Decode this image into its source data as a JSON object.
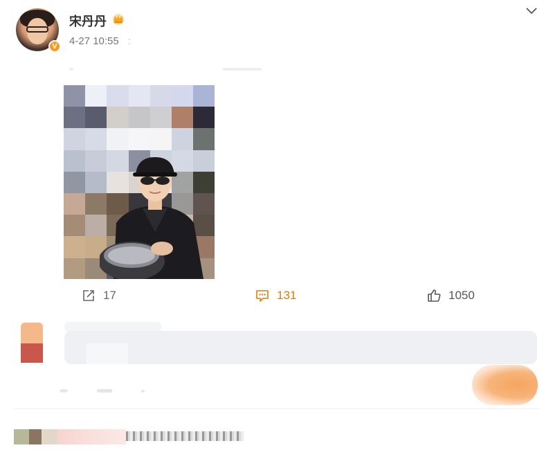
{
  "post": {
    "author": "宋丹丹",
    "verified_badge": "V",
    "time": "4-27 10:55",
    "time_tail": ":",
    "menu_icon": "chevron-down-icon",
    "crown_icon": "crown-icon"
  },
  "actions": {
    "forward_count": "17",
    "comment_count": "131",
    "like_count": "1050",
    "comment_color": "#e07b0c"
  },
  "mosaic_colors": [
    [
      "#8e93a8",
      "#eef0f8",
      "#d9dced",
      "#e4e7f3",
      "#d6d9ea",
      "#d4d8ec",
      "#a9b4d7"
    ],
    [
      "#6d6f83",
      "#5a5c6e",
      "#d2cfca",
      "#c6c5c7",
      "#cfcfd2",
      "#b07f68",
      "#2b2a36"
    ],
    [
      "#cfd4e0",
      "#d7dbe6",
      "#f1f2f5",
      "#f6f6f8",
      "#f5f5f6",
      "#cdd3df",
      "#6c7270"
    ],
    [
      "#bac1ce",
      "#c7ccd8",
      "#d3d8e3",
      "#8b8fa0",
      "#cdd3df",
      "#d5d9e3",
      "#c9cfda"
    ],
    [
      "#9097a3",
      "#b5bbc8",
      "#e5e2e0",
      "#d9d4d0",
      "#e9e9ec",
      "#a1a3a3",
      "#3d3e34"
    ],
    [
      "#c6a897",
      "#8c7a66",
      "#6d5a48",
      "#39373c",
      "#3e3b40",
      "#9a9896",
      "#5f5450"
    ],
    [
      "#a58c77",
      "#bcaea5",
      "#7b6a58",
      "#2f2c31",
      "#322f34",
      "#cab8ae",
      "#5a4f45"
    ],
    [
      "#cdb08e",
      "#c7ad8a",
      "#a08d76",
      "#4a4c53",
      "#6e6d73",
      "#3f3b40",
      "#9b7866"
    ],
    [
      "#b39b82",
      "#9a8a77",
      "#5e5a5c",
      "#565459",
      "#6d6a6c",
      "#3d7a42",
      "#a5917f"
    ]
  ]
}
